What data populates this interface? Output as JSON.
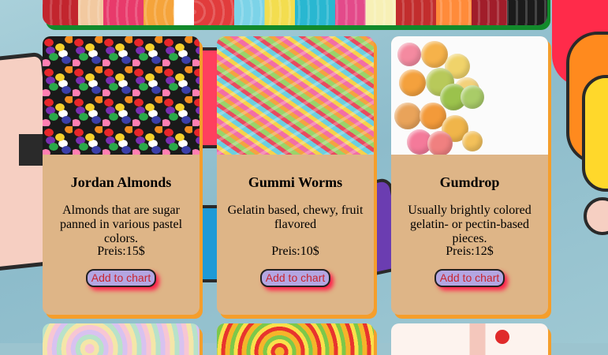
{
  "products": [
    {
      "name": "Jordan Almonds",
      "description": "Almonds that are sugar panned in various pastel colors.",
      "price": "Preis:15$",
      "button_label": "Add to chart",
      "image": "jordan-almonds-photo"
    },
    {
      "name": "Gummi Worms",
      "description": "Gelatin based, chewy, fruit flavored",
      "price": "Preis:10$",
      "button_label": "Add to chart",
      "image": "gummi-worms-photo"
    },
    {
      "name": "Gumdrop",
      "description": "Usually brightly colored gelatin- or pectin-based pieces.",
      "price": "Preis:12$",
      "button_label": "Add to chart",
      "image": "gumdrop-photo"
    }
  ],
  "colors": {
    "card_bg": "#deb587",
    "card_shadow": "#f59e2b",
    "banner_shadow": "#128a2b",
    "button_bg": "#b4a6e2",
    "button_text": "#c9252f",
    "button_glow": "#ff1f4a"
  }
}
